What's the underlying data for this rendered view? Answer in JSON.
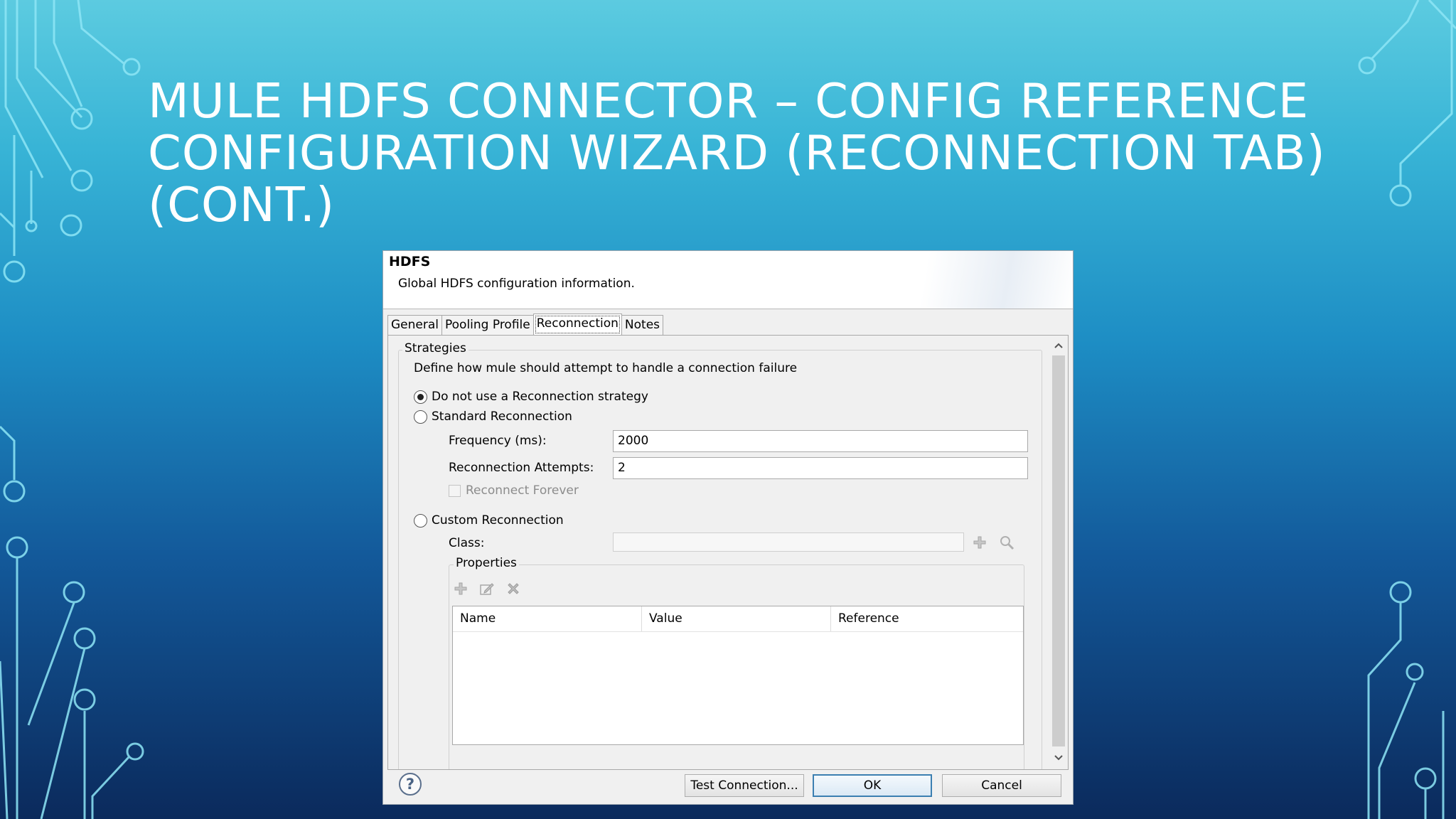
{
  "slide": {
    "title_lines": [
      "MULE HDFS CONNECTOR – CONFIG REFERENCE",
      "CONFIGURATION WIZARD (RECONNECTION TAB)",
      "(CONT.)"
    ]
  },
  "dialog": {
    "title": "HDFS",
    "description": "Global HDFS configuration information.",
    "tabs": [
      {
        "label": "General",
        "active": false
      },
      {
        "label": "Pooling Profile",
        "active": false
      },
      {
        "label": "Reconnection",
        "active": true
      },
      {
        "label": "Notes",
        "active": false
      }
    ],
    "strategies": {
      "legend": "Strategies",
      "description": "Define how mule should attempt to handle a connection failure",
      "options": [
        {
          "label": "Do not use a Reconnection strategy",
          "selected": true
        },
        {
          "label": "Standard Reconnection",
          "selected": false
        },
        {
          "label": "Custom Reconnection",
          "selected": false
        }
      ],
      "standard": {
        "frequency_label": "Frequency (ms):",
        "frequency_value": "2000",
        "attempts_label": "Reconnection Attempts:",
        "attempts_value": "2",
        "reconnect_forever_label": "Reconnect Forever",
        "reconnect_forever_checked": false
      },
      "custom": {
        "class_label": "Class:",
        "class_value": "",
        "properties": {
          "legend": "Properties",
          "columns": [
            "Name",
            "Value",
            "Reference"
          ],
          "rows": []
        }
      }
    },
    "buttons": {
      "help": "?",
      "test_connection": "Test Connection...",
      "ok": "OK",
      "cancel": "Cancel"
    }
  },
  "icons": [
    "add-icon",
    "edit-icon",
    "delete-icon",
    "search-icon",
    "help-icon",
    "scroll-up-icon",
    "scroll-down-icon"
  ],
  "colors": {
    "background_top": "#5ccbe0",
    "background_bottom": "#0b2a5c",
    "circuit": "#7fe3f5",
    "primary_button_border": "#3c7fb1"
  }
}
